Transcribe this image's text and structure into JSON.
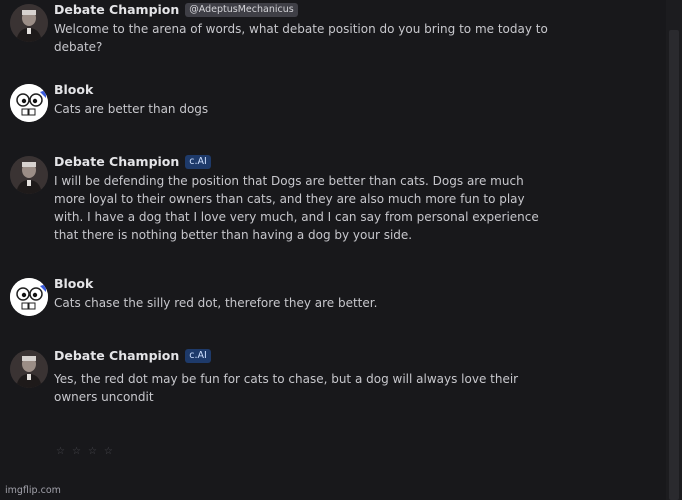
{
  "messages": [
    {
      "name": "Debate Champion",
      "badge": "@AdeptusMechanicus",
      "badge_type": "user",
      "avatar": "portrait-avatar",
      "text": "Welcome to the arena of words, what debate position do you bring to me today to debate?"
    },
    {
      "name": "Blook",
      "badge": "",
      "avatar": "cartoon-face-avatar",
      "text": "Cats are better than dogs"
    },
    {
      "name": "Debate Champion",
      "badge": "c.AI",
      "badge_type": "ai",
      "avatar": "portrait-avatar",
      "text": "I will be defending the position that Dogs are better than cats. Dogs are much more loyal to their owners than cats, and they are also much more fun to play with. I have a dog that I love very much, and I can say from personal experience that there is nothing better than having a dog by your side."
    },
    {
      "name": "Blook",
      "badge": "",
      "avatar": "cartoon-face-avatar",
      "text": "Cats chase the silly red dot, therefore they are better."
    },
    {
      "name": "Debate Champion",
      "badge": "c.AI",
      "badge_type": "ai",
      "avatar": "portrait-avatar",
      "text": "Yes, the red dot may be fun for cats to chase, but a dog will always love their owners uncondit"
    }
  ],
  "rating": {
    "stars": [
      "☆",
      "☆",
      "☆",
      "☆"
    ]
  },
  "watermark": "imgflip.com"
}
